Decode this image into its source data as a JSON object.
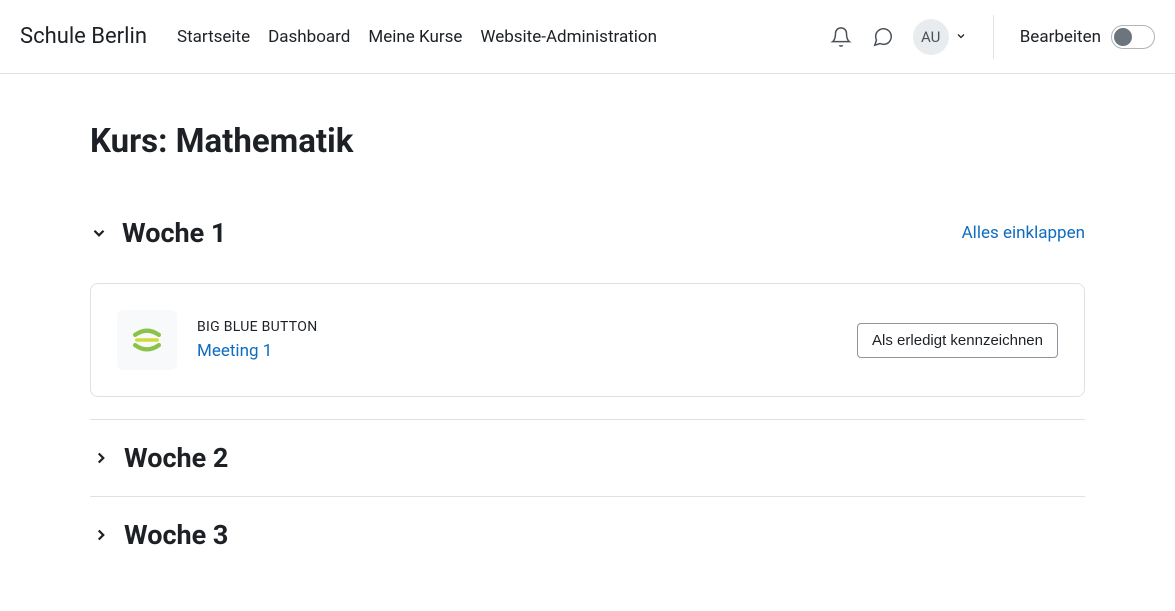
{
  "navbar": {
    "brand": "Schule Berlin",
    "links": [
      "Startseite",
      "Dashboard",
      "Meine Kurse",
      "Website-Administration"
    ],
    "avatar": "AU",
    "edit_label": "Bearbeiten"
  },
  "course": {
    "title": "Kurs: Mathematik",
    "collapse_all": "Alles einklappen",
    "sections": [
      {
        "title": "Woche 1",
        "expanded": true,
        "activities": [
          {
            "type_label": "BIG BLUE BUTTON",
            "name": "Meeting 1",
            "mark_done_label": "Als erledigt kennzeichnen"
          }
        ]
      },
      {
        "title": "Woche 2",
        "expanded": false
      },
      {
        "title": "Woche 3",
        "expanded": false
      }
    ]
  }
}
